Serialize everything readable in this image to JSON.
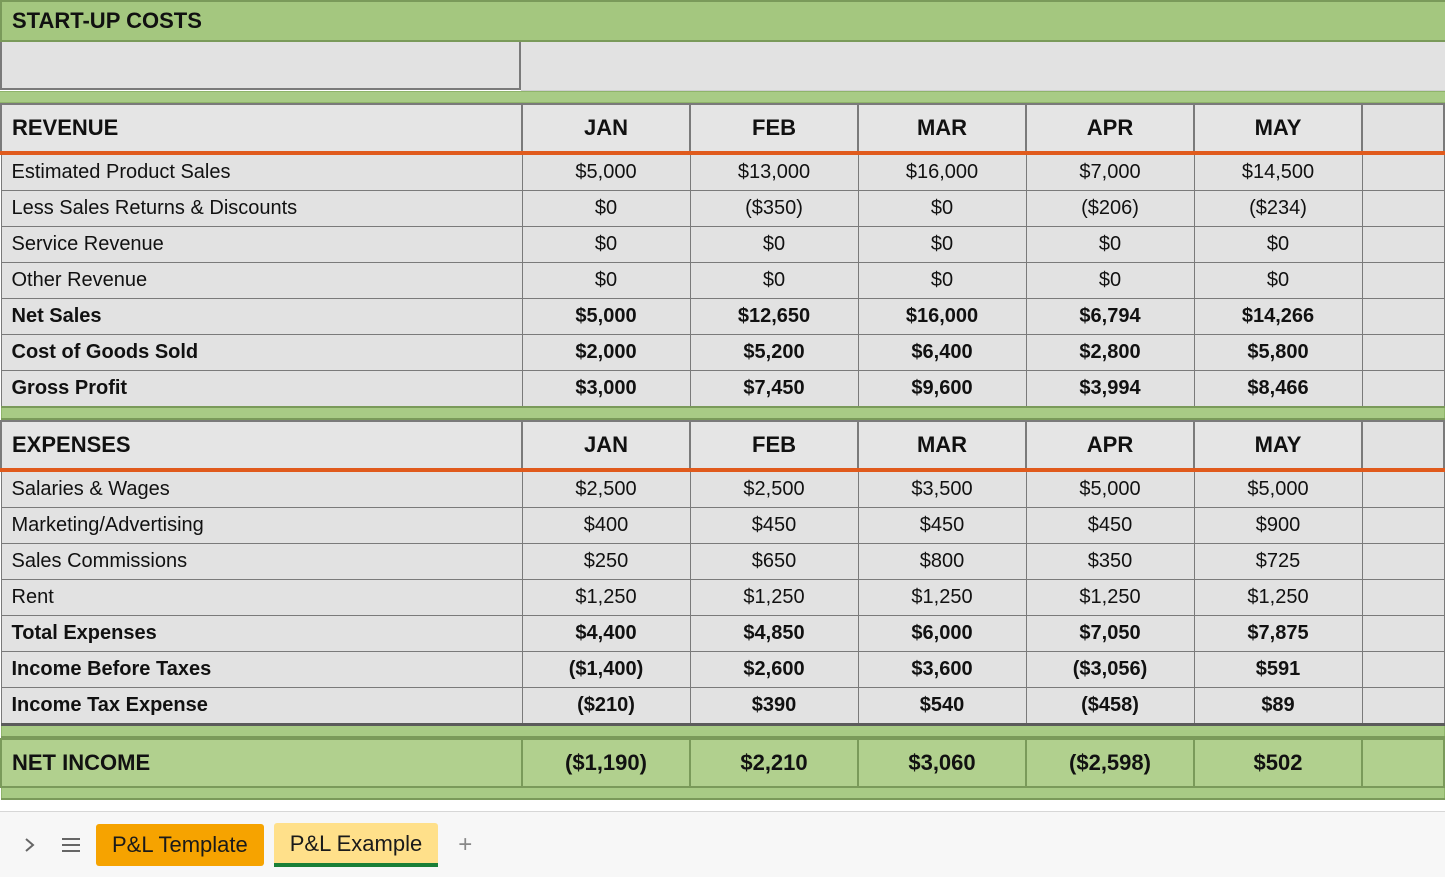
{
  "title": "START-UP COSTS",
  "months": [
    "JAN",
    "FEB",
    "MAR",
    "APR",
    "MAY"
  ],
  "revenue": {
    "header": "REVENUE",
    "rows": [
      {
        "label": "Estimated Product Sales",
        "bold": false,
        "values": [
          "$5,000",
          "$13,000",
          "$16,000",
          "$7,000",
          "$14,500"
        ]
      },
      {
        "label": "Less Sales Returns & Discounts",
        "bold": false,
        "values": [
          "$0",
          "($350)",
          "$0",
          "($206)",
          "($234)"
        ]
      },
      {
        "label": "Service Revenue",
        "bold": false,
        "values": [
          "$0",
          "$0",
          "$0",
          "$0",
          "$0"
        ]
      },
      {
        "label": "Other Revenue",
        "bold": false,
        "values": [
          "$0",
          "$0",
          "$0",
          "$0",
          "$0"
        ]
      },
      {
        "label": "Net Sales",
        "bold": true,
        "values": [
          "$5,000",
          "$12,650",
          "$16,000",
          "$6,794",
          "$14,266"
        ]
      },
      {
        "label": "Cost of Goods Sold",
        "bold": true,
        "values": [
          "$2,000",
          "$5,200",
          "$6,400",
          "$2,800",
          "$5,800"
        ]
      },
      {
        "label": "Gross Profit",
        "bold": true,
        "values": [
          "$3,000",
          "$7,450",
          "$9,600",
          "$3,994",
          "$8,466"
        ]
      }
    ]
  },
  "expenses": {
    "header": "EXPENSES",
    "rows": [
      {
        "label": "Salaries & Wages",
        "bold": false,
        "values": [
          "$2,500",
          "$2,500",
          "$3,500",
          "$5,000",
          "$5,000"
        ]
      },
      {
        "label": "Marketing/Advertising",
        "bold": false,
        "values": [
          "$400",
          "$450",
          "$450",
          "$450",
          "$900"
        ]
      },
      {
        "label": "Sales Commissions",
        "bold": false,
        "values": [
          "$250",
          "$650",
          "$800",
          "$350",
          "$725"
        ]
      },
      {
        "label": "Rent",
        "bold": false,
        "values": [
          "$1,250",
          "$1,250",
          "$1,250",
          "$1,250",
          "$1,250"
        ]
      },
      {
        "label": "Total Expenses",
        "bold": true,
        "values": [
          "$4,400",
          "$4,850",
          "$6,000",
          "$7,050",
          "$7,875"
        ]
      },
      {
        "label": "Income Before Taxes",
        "bold": true,
        "values": [
          "($1,400)",
          "$2,600",
          "$3,600",
          "($3,056)",
          "$591"
        ]
      },
      {
        "label": "Income Tax Expense",
        "bold": true,
        "values": [
          "($210)",
          "$390",
          "$540",
          "($458)",
          "$89"
        ]
      }
    ]
  },
  "net_income": {
    "label": "NET INCOME",
    "values": [
      "($1,190)",
      "$2,210",
      "$3,060",
      "($2,598)",
      "$502"
    ]
  },
  "tabs": {
    "items": [
      {
        "label": "P&L Template",
        "active": true
      },
      {
        "label": "P&L Example",
        "active": false
      }
    ]
  }
}
